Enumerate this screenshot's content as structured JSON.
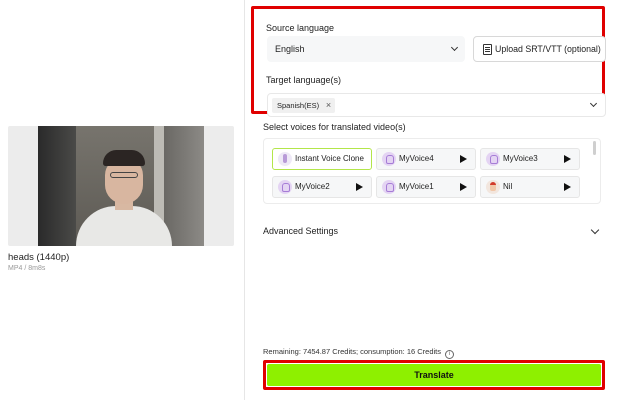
{
  "media": {
    "file_name": "heads (1440p)",
    "file_meta": "MP4 / 8m8s"
  },
  "source_language": {
    "label": "Source language",
    "value": "English",
    "upload_label": "Upload SRT/VTT (optional)"
  },
  "target_language": {
    "label": "Target language(s)",
    "tags": [
      "Spanish(ES)"
    ],
    "remove_icon": "×"
  },
  "voices": {
    "label": "Select voices for translated video(s)",
    "items": [
      {
        "name": "Instant Voice Clone",
        "icon": "microphone-icon",
        "selected": true
      },
      {
        "name": "MyVoice4",
        "icon": "voice-avatar-icon"
      },
      {
        "name": "MyVoice3",
        "icon": "voice-avatar-icon"
      },
      {
        "name": "MyVoice2",
        "icon": "voice-avatar-icon"
      },
      {
        "name": "MyVoice1",
        "icon": "voice-avatar-icon"
      },
      {
        "name": "Nil",
        "icon": "person-avatar-icon"
      }
    ]
  },
  "advanced": {
    "label": "Advanced Settings"
  },
  "credits": {
    "text": "Remaining: 7454.87 Credits; consumption: 16 Credits",
    "info_icon": "i"
  },
  "actions": {
    "translate_label": "Translate"
  },
  "colors": {
    "accent_green": "#8ef000",
    "highlight_red": "#e00000"
  }
}
